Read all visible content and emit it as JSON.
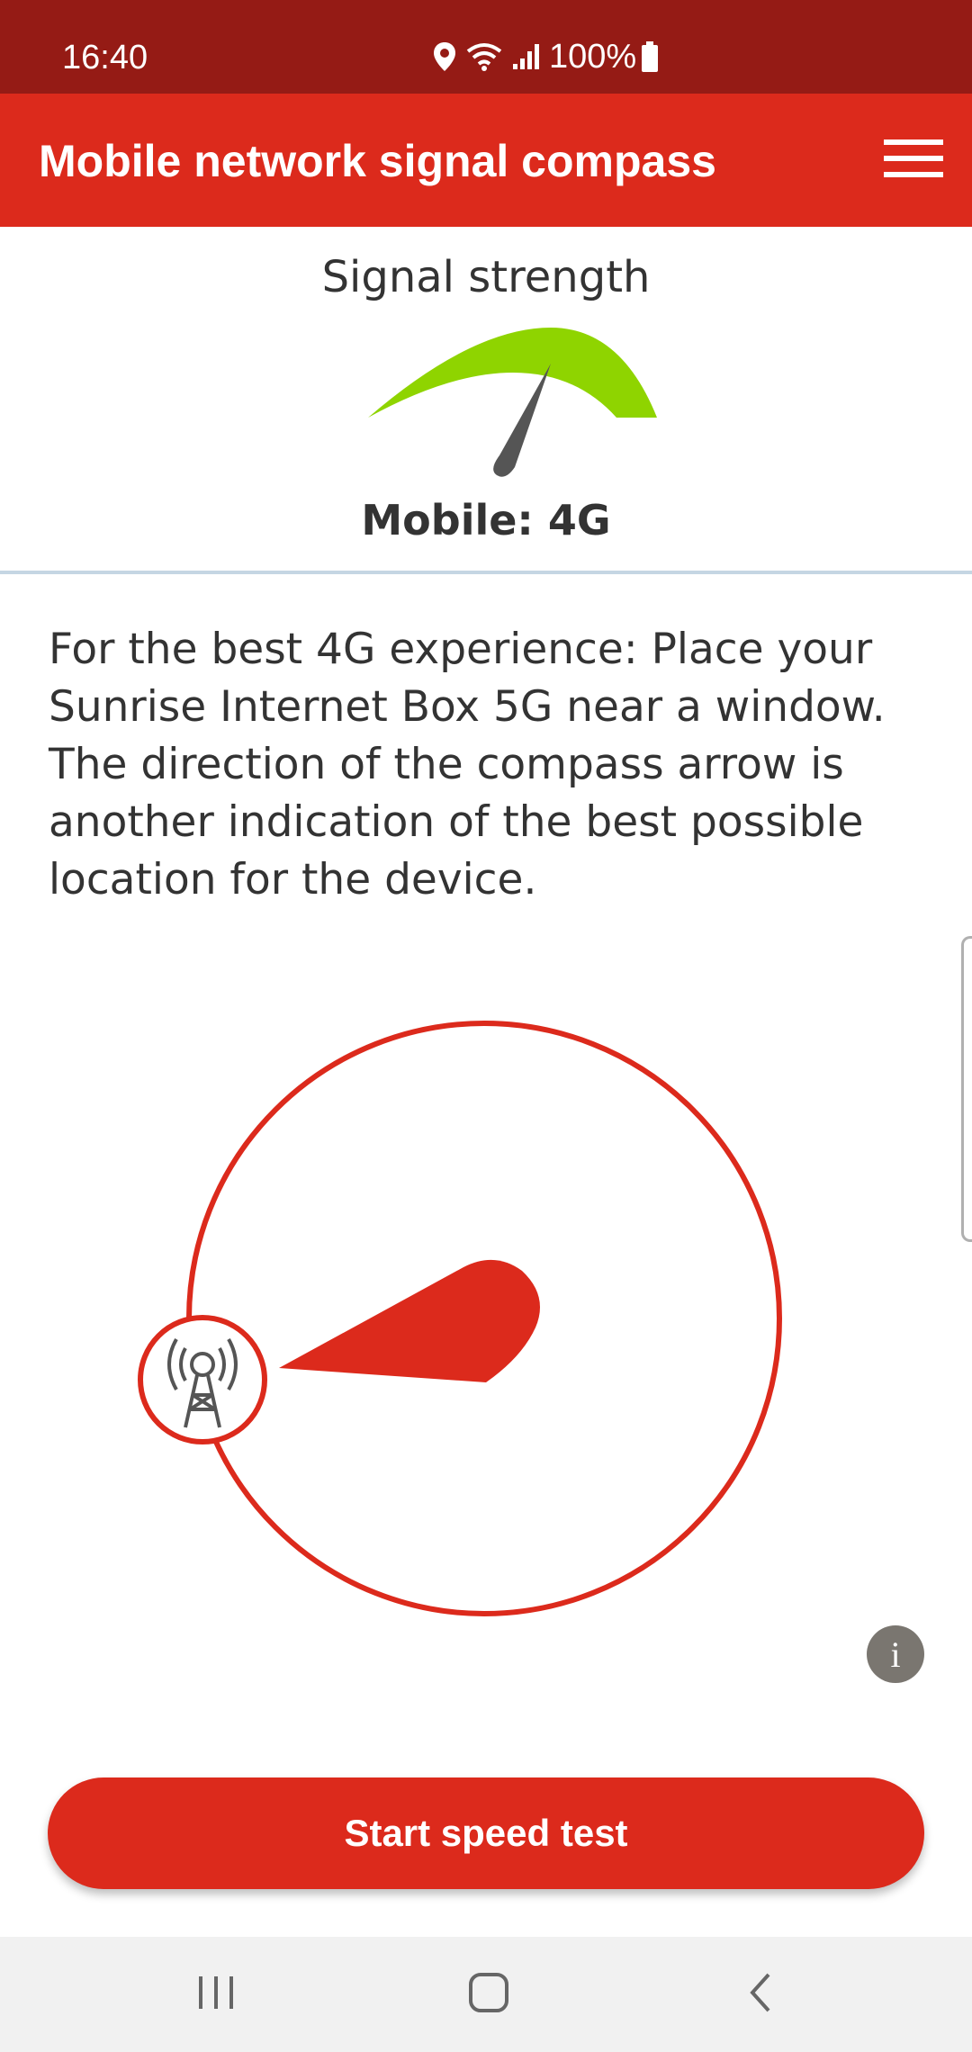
{
  "status_bar": {
    "time": "16:40",
    "battery_text": "100%",
    "icons": [
      "location-icon",
      "wifi-icon",
      "cellular-signal-icon",
      "battery-icon"
    ]
  },
  "app_bar": {
    "title": "Mobile network signal compass",
    "menu_icon": "hamburger-menu-icon"
  },
  "signal": {
    "label": "Signal strength",
    "type": "Mobile: 4G",
    "gauge_color": "#8fd400"
  },
  "instructions": "For the best 4G experience: Place your Sunrise Internet Box 5G near a window. The direction of the compass arrow is another indication of the best possible location for the device.",
  "compass": {
    "ring_color": "#dc2a1c",
    "tower_icon": "cell-tower-icon"
  },
  "info_button": {
    "label": "i",
    "icon": "info-icon"
  },
  "speed_test_button": {
    "label": "Start speed test"
  },
  "nav_bar": {
    "icons": [
      "recent-apps-icon",
      "home-icon",
      "back-icon"
    ]
  },
  "colors": {
    "accent": "#dc2a1c",
    "status_bar": "#951b15",
    "text": "#333333"
  }
}
